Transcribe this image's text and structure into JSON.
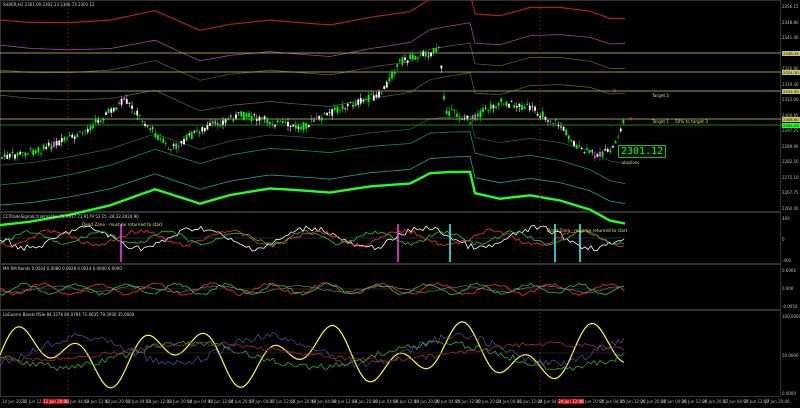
{
  "colors": {
    "bg": "#000000",
    "candle_up": "#00ff00",
    "candle_down": "#ffffff",
    "band_red": "#ff2020",
    "band_green": "#22ff22",
    "level": "#c8c864"
  },
  "main": {
    "title": "SILVER,H1 2301.00 2302.13 2300.73 2301.12",
    "last_price": "2301.12",
    "annotations": {
      "target2": "Target 2",
      "target1": "Target 1",
      "half": "50% to target 3",
      "stop": "stoploss"
    },
    "scale_labels": [
      "2356.15",
      "2348.80",
      "2341.40",
      "2334.00",
      "2326.80",
      "2319.40",
      "2312.00",
      "2304.65",
      "2297.25",
      "2289.90",
      "2282.50",
      "2275.10",
      "2267.75",
      "2260.40"
    ],
    "tags": [
      "2328.15",
      "2324.10",
      "2315.30",
      "2308.60",
      "2305.25"
    ]
  },
  "ind1": {
    "title": "CCITradeSignals trailmaster 71.4917 71.9179 53.15 -28.32 2024.90",
    "dead_zone_left": "Dead Zone - must be returned to start",
    "dead_zone_right": "Dead Zone - must be returned to start",
    "scale": [
      "400",
      "0",
      "-400"
    ]
  },
  "ind2": {
    "title": "MA RM Bands 0.0024 0.0080 0.0028 0.0014 0.0000 0.0000",
    "scale": [
      "0.0066",
      "0.000",
      "-0.0050"
    ]
  },
  "ind3": {
    "title": "LaGuerre Bands RSIo 84.3376 84.0764 71.0035 79.3930 35.0000",
    "scale": [
      "100.0000",
      "50.0000",
      "0.0000"
    ]
  },
  "time_axis": [
    "14 Jun 2024",
    "11 Jun 12:00",
    "11 Jun 20:00",
    "12 Jun 04:00",
    "12 Jun 12:00",
    "12 Jun 20:00",
    "13 Jun 04:00",
    "13 Jun 12:00",
    "13 Jun 20:00",
    "14 Jun 04:00",
    "14 Jun 12:00",
    "14 Jun 20:00",
    "17 Jun 04:00",
    "17 Jun 12:00",
    "17 Jun 20:00",
    "18 Jun 04:00",
    "18 Jun 12:00",
    "18 Jun 20:00",
    "19 Jun 04:00",
    "19 Jun 12:00",
    "19 Jun 20:00",
    "20 Jun 04:00",
    "20 Jun 12:00",
    "20 Jun 20:00",
    "21 Jun 04:00",
    "21 Jun 12:00",
    "24 Jun 04:00",
    "24 Jun 12:00",
    "24 Jun 20:00",
    "25 Jun 04:00",
    "25 Jun 12:00",
    "25 Jun 20:00",
    "26 Jun 04:00",
    "26 Jun 12:00",
    "26 Jun 20:00",
    "27 Jun 04:00",
    "27 Jun 12:00",
    "27 Jun 20:00"
  ]
}
